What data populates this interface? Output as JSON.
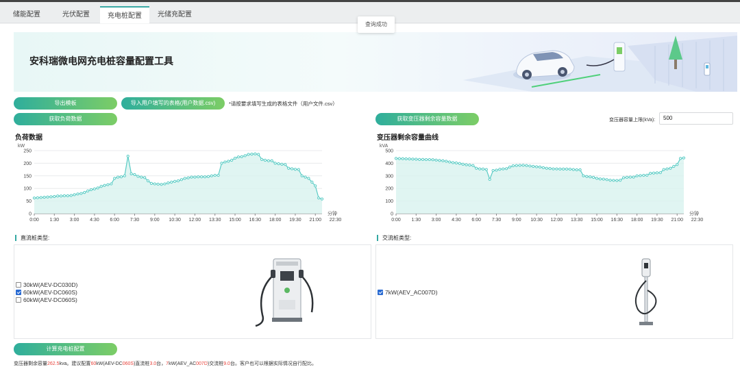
{
  "tabs": [
    {
      "label": "储能配置",
      "active": false
    },
    {
      "label": "光伏配置",
      "active": false
    },
    {
      "label": "充电桩配置",
      "active": true
    },
    {
      "label": "光储充配置",
      "active": false
    }
  ],
  "toast": "查询成功",
  "banner": {
    "title": "安科瑞微电网充电桩容量配置工具"
  },
  "buttons": {
    "export_template": "导出模板",
    "import_user_table": "导入用户填写的表格(用户数据.csv)",
    "get_load_data": "获取负荷数据",
    "get_transformer_data": "获取变压器剩余容量数据",
    "calculate": "计算充电桩配置"
  },
  "import_note": "*请按要求填写生成的表格文件（用户文件.csv）",
  "transformer": {
    "label": "变压器容量上限(kVa):",
    "value": "500"
  },
  "load_chart_title": "负荷数据",
  "transformer_chart_title": "变压器剩余容量曲线",
  "dc_section": {
    "label": "直流桩类型:",
    "options": [
      {
        "text": "30kW(AEV-DC030D)",
        "checked": false
      },
      {
        "text": "60kW(AEV-DC060S)",
        "checked": true
      },
      {
        "text": "60kW(AEV-DC060S)",
        "checked": false
      }
    ]
  },
  "ac_section": {
    "label": "交流桩类型:",
    "options": [
      {
        "text": "7kW(AEV_AC007D)",
        "checked": true
      }
    ]
  },
  "result": {
    "p1": "变压器剩余容量",
    "v1": "262.5",
    "p2": "kva。建议配置",
    "v2": "60",
    "p3": "kW(AEV-DC",
    "v3": "060S",
    "p4": ")直流桩",
    "v4": "3.0",
    "p5": "台，",
    "v5": "7",
    "p6": "kW(AEV_AC",
    "v6": "007D",
    "p7": ")交流桩",
    "v7": "9.0",
    "p8": "台。客户也可以根据实际情况自行配比。"
  },
  "colors": {
    "accent": "#2fae9c",
    "accent_end": "#7ccd66",
    "line": "#58cbc4",
    "highlight": "#e8423a"
  },
  "chart_data": [
    {
      "type": "area",
      "title": "负荷数据",
      "ylabel": "kW",
      "xlabel": "分钟",
      "ylim": [
        0,
        250
      ],
      "yticks": [
        0,
        50,
        100,
        150,
        200,
        250
      ],
      "xticks": [
        "0:00",
        "1:30",
        "3:00",
        "4:30",
        "6:00",
        "7:30",
        "9:00",
        "10:30",
        "12:00",
        "13:30",
        "15:00",
        "16:30",
        "18:00",
        "19:30",
        "21:00",
        "22:30"
      ],
      "x_interval_minutes": 15,
      "series": [
        {
          "values": [
            62,
            63,
            64,
            65,
            66,
            67,
            68,
            70,
            70,
            71,
            71,
            72,
            75,
            78,
            80,
            84,
            90,
            95,
            98,
            102,
            108,
            112,
            115,
            118,
            140,
            145,
            146,
            150,
            228,
            158,
            155,
            148,
            145,
            143,
            130,
            120,
            118,
            117,
            116,
            118,
            122,
            125,
            128,
            130,
            135,
            140,
            142,
            145,
            145,
            146,
            146,
            146,
            147,
            150,
            152,
            152,
            200,
            205,
            208,
            212,
            220,
            225,
            226,
            230,
            235,
            236,
            237,
            235,
            215,
            212,
            210,
            210,
            200,
            198,
            196,
            195,
            180,
            178,
            176,
            175,
            150,
            145,
            140,
            125,
            110,
            62,
            58
          ]
        }
      ]
    },
    {
      "type": "area",
      "title": "变压器剩余容量曲线",
      "ylabel": "kVA",
      "xlabel": "分钟",
      "ylim": [
        0,
        500
      ],
      "yticks": [
        0,
        100,
        200,
        300,
        400,
        500
      ],
      "xticks": [
        "0:00",
        "1:30",
        "3:00",
        "4:30",
        "6:00",
        "7:30",
        "9:00",
        "10:30",
        "12:00",
        "13:30",
        "15:00",
        "16:30",
        "18:00",
        "19:30",
        "21:00",
        "22:30"
      ],
      "x_interval_minutes": 15,
      "series": [
        {
          "values": [
            438,
            437,
            436,
            435,
            434,
            433,
            432,
            430,
            430,
            429,
            429,
            428,
            425,
            422,
            420,
            416,
            410,
            405,
            402,
            398,
            392,
            388,
            385,
            382,
            360,
            355,
            354,
            350,
            272,
            342,
            345,
            352,
            355,
            357,
            370,
            380,
            382,
            383,
            384,
            382,
            378,
            375,
            372,
            370,
            365,
            360,
            358,
            355,
            355,
            354,
            354,
            354,
            353,
            350,
            348,
            348,
            300,
            295,
            292,
            288,
            280,
            275,
            274,
            270,
            265,
            264,
            263,
            265,
            285,
            288,
            290,
            290,
            300,
            302,
            304,
            305,
            320,
            322,
            324,
            325,
            350,
            355,
            360,
            375,
            390,
            438,
            442
          ]
        }
      ]
    }
  ]
}
